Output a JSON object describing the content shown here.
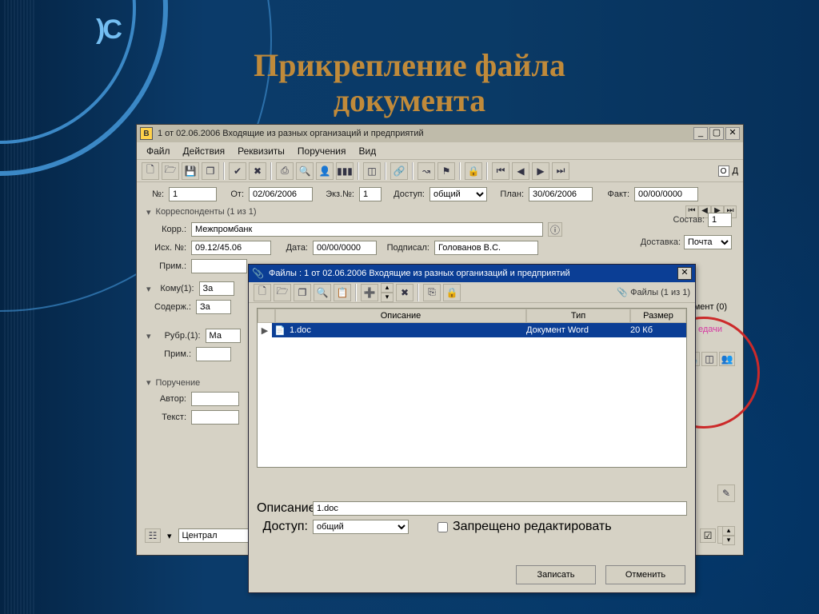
{
  "slide": {
    "title_l1": "Прикрепление файла",
    "title_l2": "документа",
    "logo": ")С"
  },
  "main": {
    "title": "1 от 02.06.2006 Входящие из разных организаций и предприятий",
    "app_icon": "В",
    "menubar": [
      "Файл",
      "Действия",
      "Реквизиты",
      "Поручения",
      "Вид"
    ],
    "toolbar_right": {
      "o": "О",
      "d": "Д"
    },
    "fields": {
      "no_label": "№:",
      "no_value": "1",
      "from_label": "От:",
      "from_value": "02/06/2006",
      "ekz_label": "Экз.№:",
      "ekz_value": "1",
      "access_label": "Доступ:",
      "access_value": "общий",
      "plan_label": "План:",
      "plan_value": "30/06/2006",
      "fact_label": "Факт:",
      "fact_value": "00/00/0000"
    },
    "section_corr": "Корреспонденты (1 из 1)",
    "corr_label": "Корр.:",
    "corr_value": "Межпромбанк",
    "outno_label": "Исх. №:",
    "outno_value": "09.12/45.06",
    "date_label": "Дата:",
    "date_value": "00/00/0000",
    "signed_label": "Подписал:",
    "signed_value": "Голованов В.С.",
    "prim_label": "Прим.:",
    "komu_label": "Кому(1):",
    "komu_value": "За",
    "soder_label": "Содерж.:",
    "soder_value": "За",
    "rubr_label": "Рубр.(1):",
    "rubr_value": "Ма",
    "section_assign": "Поручение",
    "author_label": "Автор:",
    "text_label": "Текст:",
    "footer_cab": "Централ"
  },
  "side": {
    "sostav_label": "Состав:",
    "sostav_value": "1",
    "dost_label": "Доставка:",
    "dost_value": "Почта",
    "ment": "мент (0)",
    "send": "едачи"
  },
  "dialog": {
    "title": "Файлы : 1 от 02.06.2006 Входящие из разных организаций и предприятий",
    "files_count": "Файлы (1 из 1)",
    "cols": {
      "desc": "Описание",
      "type": "Тип",
      "size": "Размер"
    },
    "row": {
      "name": "1.doc",
      "type": "Документ Word",
      "size": "20 Кб"
    },
    "desc_label": "Описание:",
    "desc_value": "1.doc",
    "access_label": "Доступ:",
    "access_value": "общий",
    "readonly_label": "Запрещено редактировать",
    "save": "Записать",
    "cancel": "Отменить"
  }
}
